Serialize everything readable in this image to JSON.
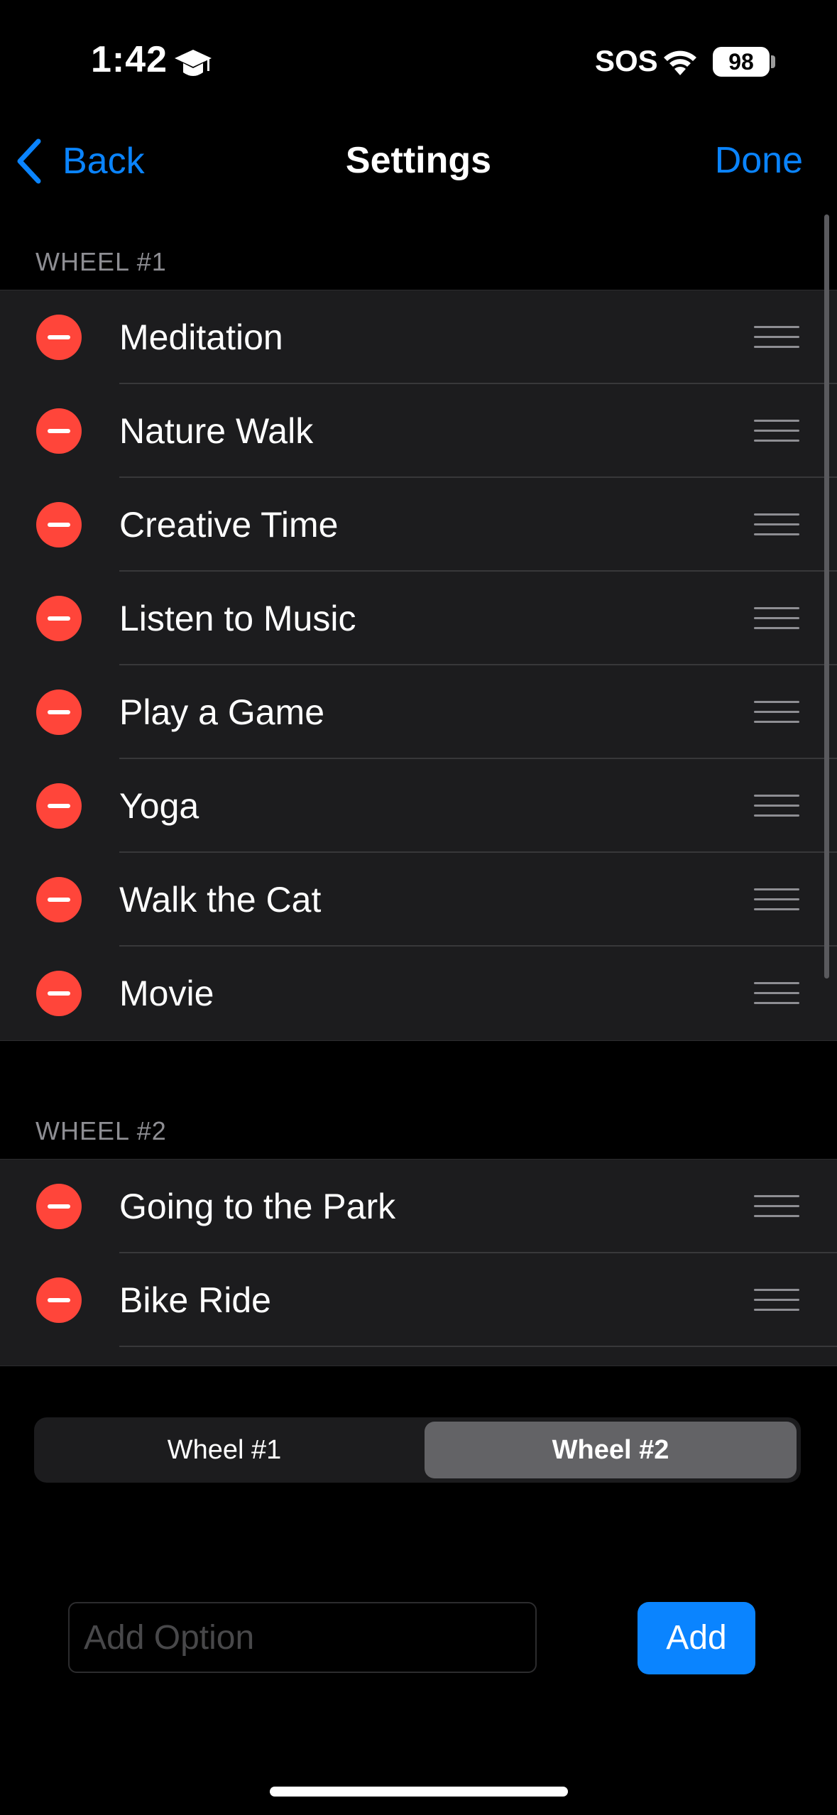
{
  "status_bar": {
    "time": "1:42",
    "sos": "SOS",
    "battery": "98",
    "icons": [
      "graduation-cap-icon",
      "wifi-icon",
      "battery-icon"
    ]
  },
  "nav": {
    "back_label": "Back",
    "title": "Settings",
    "done_label": "Done"
  },
  "sections": [
    {
      "header": "WHEEL #1",
      "items": [
        {
          "label": "Meditation"
        },
        {
          "label": "Nature Walk"
        },
        {
          "label": "Creative Time"
        },
        {
          "label": "Listen to Music"
        },
        {
          "label": "Play a Game"
        },
        {
          "label": "Yoga"
        },
        {
          "label": "Walk the Cat"
        },
        {
          "label": "Movie"
        }
      ]
    },
    {
      "header": "WHEEL #2",
      "items": [
        {
          "label": "Going to the Park"
        },
        {
          "label": "Bike Ride"
        }
      ]
    }
  ],
  "segmented": {
    "options": [
      "Wheel #1",
      "Wheel #2"
    ],
    "selected": "Wheel #2"
  },
  "add": {
    "placeholder": "Add Option",
    "value": "",
    "button_label": "Add"
  },
  "colors": {
    "accent": "#0a84ff",
    "delete": "#ff453a",
    "row_bg": "#1c1c1e",
    "background": "#000000"
  }
}
